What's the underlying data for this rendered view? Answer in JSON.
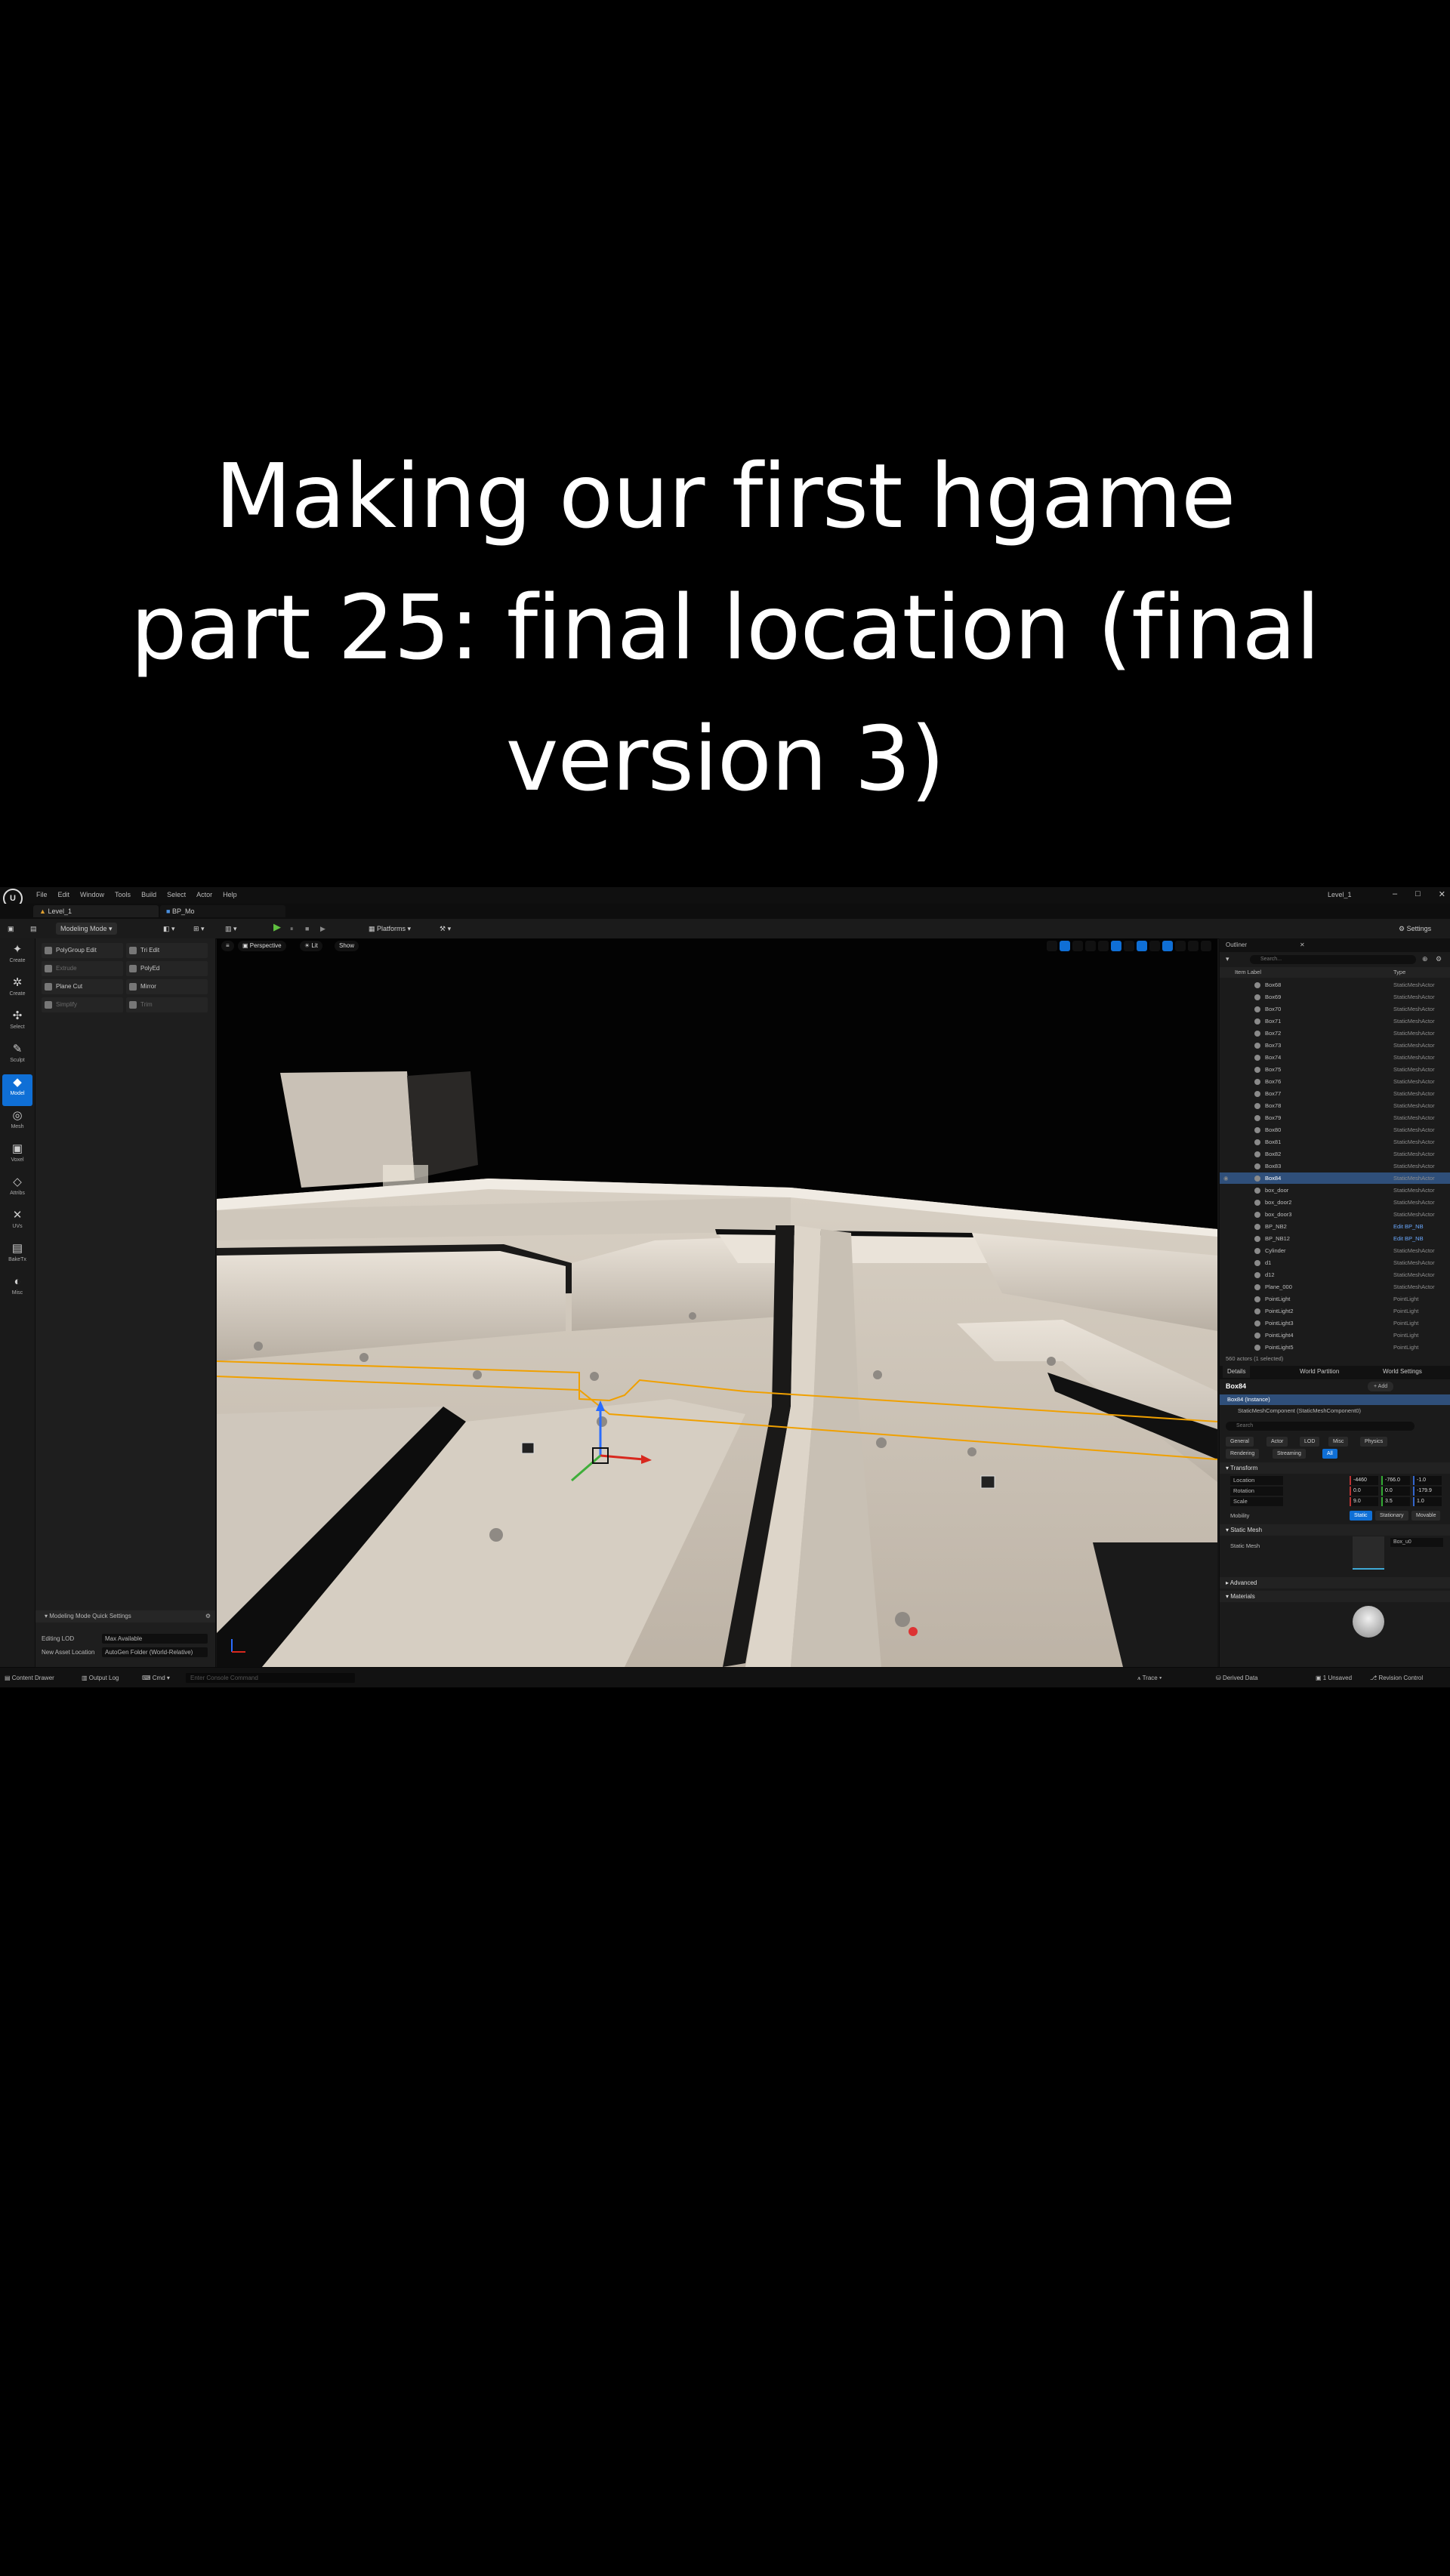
{
  "caption": {
    "line1": "Making our first hgame",
    "line2": "part 25: final location (final",
    "line3": "version 3)"
  },
  "menu": [
    "File",
    "Edit",
    "Window",
    "Tools",
    "Build",
    "Select",
    "Actor",
    "Help"
  ],
  "window_title": "Level_1",
  "tabs": [
    "Level_1",
    "BP_Mo"
  ],
  "toolbar": {
    "mode": "Modeling Mode",
    "platforms": "Platforms",
    "settings": "Settings"
  },
  "left_strip": [
    "Create",
    "Create",
    "Select",
    "Sculpt",
    "Model",
    "Mesh",
    "Voxel",
    "Attribs",
    "UVs",
    "BakeTx",
    "Misc"
  ],
  "tools": [
    [
      "PolyGroup Edit",
      "Tri Edit"
    ],
    [
      "Extrude",
      "PolyEd"
    ],
    [
      "Plane Cut",
      "Mirror"
    ],
    [
      "Simplify",
      "Trim"
    ]
  ],
  "modeling_settings": {
    "header": "Modeling Mode Quick Settings",
    "rows": [
      {
        "label": "Editing LOD",
        "value": "Max Available"
      },
      {
        "label": "New Asset Location",
        "value": "AutoGen Folder (World-Relative)"
      }
    ]
  },
  "viewport": {
    "perspective": "Perspective",
    "lit": "Lit",
    "show": "Show"
  },
  "outliner": {
    "tab": "Outliner",
    "search": "Search...",
    "col_label": "Item Label",
    "col_type": "Type",
    "rows": [
      {
        "name": "Box68",
        "type": "StaticMeshActor"
      },
      {
        "name": "Box69",
        "type": "StaticMeshActor"
      },
      {
        "name": "Box70",
        "type": "StaticMeshActor"
      },
      {
        "name": "Box71",
        "type": "StaticMeshActor"
      },
      {
        "name": "Box72",
        "type": "StaticMeshActor"
      },
      {
        "name": "Box73",
        "type": "StaticMeshActor"
      },
      {
        "name": "Box74",
        "type": "StaticMeshActor"
      },
      {
        "name": "Box75",
        "type": "StaticMeshActor"
      },
      {
        "name": "Box76",
        "type": "StaticMeshActor"
      },
      {
        "name": "Box77",
        "type": "StaticMeshActor"
      },
      {
        "name": "Box78",
        "type": "StaticMeshActor"
      },
      {
        "name": "Box79",
        "type": "StaticMeshActor"
      },
      {
        "name": "Box80",
        "type": "StaticMeshActor"
      },
      {
        "name": "Box81",
        "type": "StaticMeshActor"
      },
      {
        "name": "Box82",
        "type": "StaticMeshActor"
      },
      {
        "name": "Box83",
        "type": "StaticMeshActor"
      },
      {
        "name": "Box84",
        "type": "StaticMeshActor",
        "selected": true
      },
      {
        "name": "box_door",
        "type": "StaticMeshActor"
      },
      {
        "name": "box_door2",
        "type": "StaticMeshActor"
      },
      {
        "name": "box_door3",
        "type": "StaticMeshActor"
      },
      {
        "name": "BP_NB2",
        "type": "Edit BP_NB",
        "blueprint": true
      },
      {
        "name": "BP_NB12",
        "type": "Edit BP_NB",
        "blueprint": true
      },
      {
        "name": "Cylinder",
        "type": "StaticMeshActor"
      },
      {
        "name": "d1",
        "type": "StaticMeshActor"
      },
      {
        "name": "d12",
        "type": "StaticMeshActor"
      },
      {
        "name": "Plane_000",
        "type": "StaticMeshActor"
      },
      {
        "name": "PointLight",
        "type": "PointLight"
      },
      {
        "name": "PointLight2",
        "type": "PointLight"
      },
      {
        "name": "PointLight3",
        "type": "PointLight"
      },
      {
        "name": "PointLight4",
        "type": "PointLight"
      },
      {
        "name": "PointLight5",
        "type": "PointLight"
      }
    ],
    "footer": "560 actors (1 selected)"
  },
  "details": {
    "tabs": [
      "Details",
      "World Partition",
      "World Settings"
    ],
    "actor_name": "Box84",
    "add_label": "+ Add",
    "component_root": "Box84 (Instance)",
    "component_child": "StaticMeshComponent (StaticMeshComponent0)",
    "search": "Search",
    "filters_row1": [
      "General",
      "Actor",
      "LOD",
      "Misc",
      "Physics"
    ],
    "filters_row2": [
      "Rendering",
      "Streaming",
      "All"
    ],
    "transform_header": "Transform",
    "transform": [
      {
        "label": "Location",
        "values": [
          "-4460",
          "-766.0",
          "-1.0"
        ]
      },
      {
        "label": "Rotation",
        "values": [
          "0.0",
          "0.0",
          "-179.9"
        ]
      },
      {
        "label": "Scale",
        "values": [
          "9.0",
          "3.5",
          "1.0"
        ]
      }
    ],
    "mobility_label": "Mobility",
    "mobility": [
      "Static",
      "Stationary",
      "Movable"
    ],
    "static_mesh_header": "Static Mesh",
    "static_mesh_label": "Static Mesh",
    "static_mesh_value": "Box_u0",
    "advanced_header": "Advanced",
    "materials_header": "Materials"
  },
  "status": {
    "content_drawer": "Content Drawer",
    "output_log": "Output Log",
    "cmd": "Cmd",
    "console_placeholder": "Enter Console Command",
    "trace": "Trace",
    "derived_data": "Derived Data",
    "unsaved": "1 Unsaved",
    "revision": "Revision Control"
  },
  "colors": {
    "accent": "#0f6fd6",
    "selection_outline": "#f0a000",
    "play_green": "#5fbf3f"
  }
}
